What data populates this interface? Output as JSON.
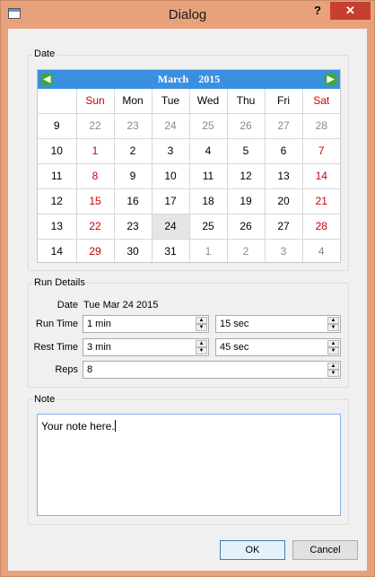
{
  "window": {
    "title": "Dialog",
    "help_label": "?",
    "close_label": "✕"
  },
  "date_group": {
    "title": "Date"
  },
  "calendar": {
    "month": "March",
    "year": "2015",
    "prev_icon": "arrow-left-icon",
    "next_icon": "arrow-right-icon",
    "day_headers": [
      "Sun",
      "Mon",
      "Tue",
      "Wed",
      "Thu",
      "Fri",
      "Sat"
    ],
    "weeks": [
      {
        "num": "9",
        "days": [
          "22",
          "23",
          "24",
          "25",
          "26",
          "27",
          "28"
        ]
      },
      {
        "num": "10",
        "days": [
          "1",
          "2",
          "3",
          "4",
          "5",
          "6",
          "7"
        ]
      },
      {
        "num": "11",
        "days": [
          "8",
          "9",
          "10",
          "11",
          "12",
          "13",
          "14"
        ]
      },
      {
        "num": "12",
        "days": [
          "15",
          "16",
          "17",
          "18",
          "19",
          "20",
          "21"
        ]
      },
      {
        "num": "13",
        "days": [
          "22",
          "23",
          "24",
          "25",
          "26",
          "27",
          "28"
        ]
      },
      {
        "num": "14",
        "days": [
          "29",
          "30",
          "31",
          "1",
          "2",
          "3",
          "4"
        ]
      }
    ],
    "selected": "Tue Mar 24 2015",
    "colors": {
      "header": "#3b8fe0",
      "weekend": "#cc0000",
      "other_month": "#8a8a8a"
    }
  },
  "run_details": {
    "title": "Run Details",
    "date_label": "Date",
    "date_value": "Tue Mar 24 2015",
    "run_time_label": "Run Time",
    "run_time_min": "1 min",
    "run_time_sec": "15 sec",
    "rest_time_label": "Rest Time",
    "rest_time_min": "3 min",
    "rest_time_sec": "45 sec",
    "reps_label": "Reps",
    "reps_value": "8"
  },
  "note": {
    "title": "Note",
    "text": "Your note here."
  },
  "buttons": {
    "ok": "OK",
    "cancel": "Cancel"
  }
}
